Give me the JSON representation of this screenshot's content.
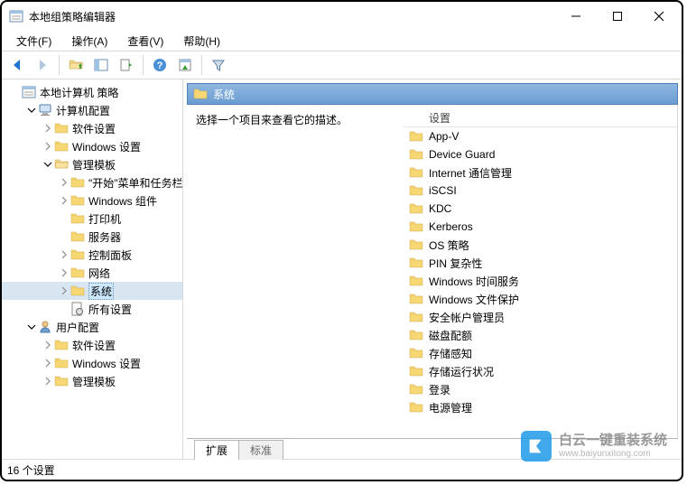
{
  "window": {
    "title": "本地组策略编辑器"
  },
  "menu": {
    "file": "文件(F)",
    "action": "操作(A)",
    "view": "查看(V)",
    "help": "帮助(H)"
  },
  "tree": {
    "root": "本地计算机 策略",
    "computer_config": "计算机配置",
    "software_settings": "软件设置",
    "windows_settings": "Windows 设置",
    "admin_templates": "管理模板",
    "start_taskbar": "\"开始\"菜单和任务栏",
    "windows_components": "Windows 组件",
    "printers": "打印机",
    "servers": "服务器",
    "control_panel": "控制面板",
    "network": "网络",
    "system": "系统",
    "all_settings": "所有设置",
    "user_config": "用户配置",
    "u_software_settings": "软件设置",
    "u_windows_settings": "Windows 设置",
    "u_admin_templates": "管理模板"
  },
  "right": {
    "header": "系统",
    "desc": "选择一个项目来查看它的描述。",
    "items": [
      "设置",
      "App-V",
      "Device Guard",
      "Internet 通信管理",
      "iSCSI",
      "KDC",
      "Kerberos",
      "OS 策略",
      "PIN 复杂性",
      "Windows 时间服务",
      "Windows 文件保护",
      "安全帐户管理员",
      "磁盘配额",
      "存储感知",
      "存储运行状况",
      "登录",
      "电源管理"
    ],
    "tab_extended": "扩展",
    "tab_standard": "标准"
  },
  "status": "16 个设置",
  "watermark": {
    "line1": "白云一键重装系统",
    "url": "www.baiyunxitong.com"
  }
}
